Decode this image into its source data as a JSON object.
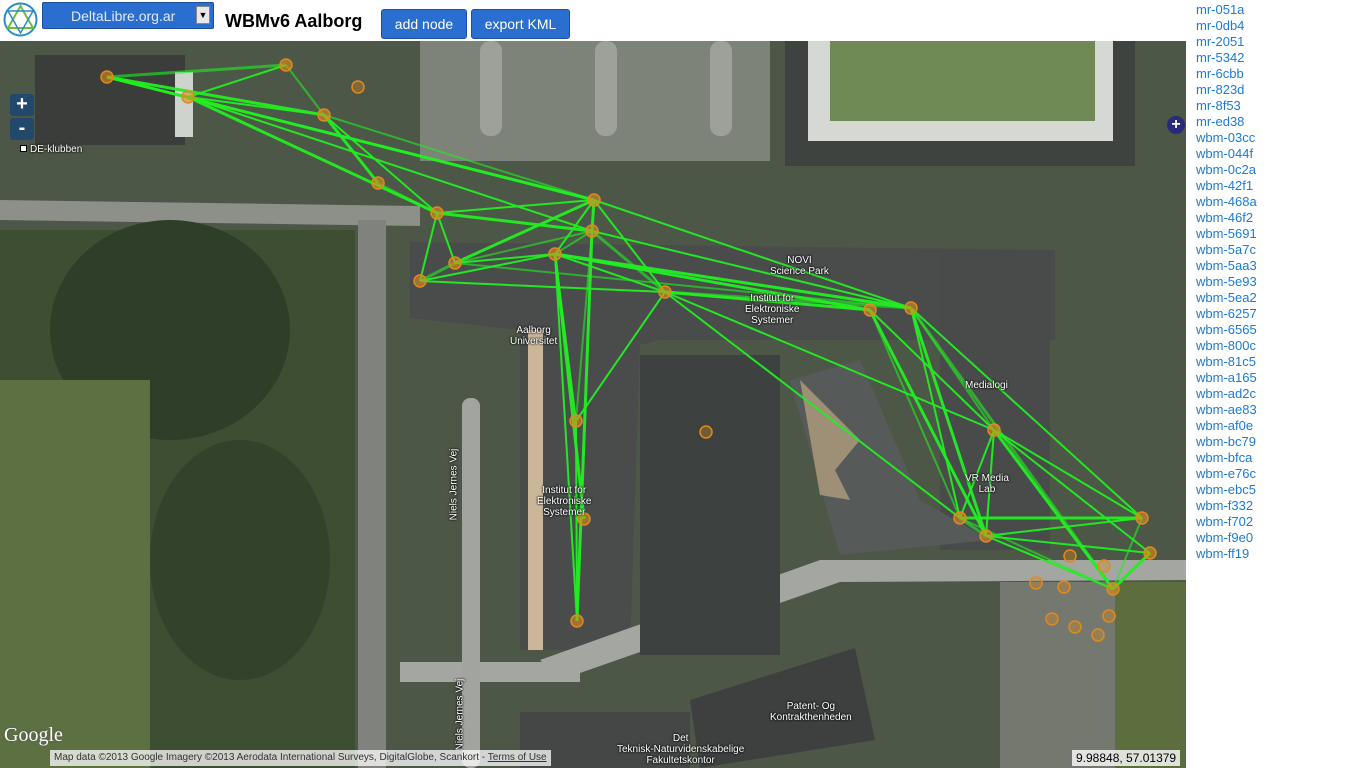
{
  "header": {
    "site_select": "DeltaLibre.org.ar",
    "title": "WBMv6 Aalborg",
    "add_node_label": "add node",
    "export_kml_label": "export KML"
  },
  "map": {
    "zoom_in": "+",
    "zoom_out": "-",
    "layer_switch": "+",
    "labels": [
      "DE-klubben",
      "NOVI\nScience Park",
      "Institut for\nElektroniske\nSystemer",
      "Aalborg\nUniversitet",
      "Medialogi",
      "VR Media\nLab",
      "Institut for\nElektroniske\nSystemer",
      "Niels Jernes Vej",
      "Niels Jernes Vej",
      "Patent- Og\nKontrakthenheden",
      "Det\nTeknisk-Naturvidenskabelige\nFakultetskontor"
    ],
    "google": "Google",
    "attribution": "Map data ©2013 Google Imagery ©2013 Aerodata International Surveys, DigitalGlobe, Scankort - ",
    "terms": "Terms of Use",
    "coordinates": "9.98848, 57.01379",
    "link_color": "#22ee22",
    "node_color": "#e08a1e"
  },
  "nodes": [
    "mr-051a",
    "mr-0db4",
    "mr-2051",
    "mr-5342",
    "mr-6cbb",
    "mr-823d",
    "mr-8f53",
    "mr-ed38",
    "wbm-03cc",
    "wbm-044f",
    "wbm-0c2a",
    "wbm-42f1",
    "wbm-468a",
    "wbm-46f2",
    "wbm-5691",
    "wbm-5a7c",
    "wbm-5aa3",
    "wbm-5e93",
    "wbm-5ea2",
    "wbm-6257",
    "wbm-6565",
    "wbm-800c",
    "wbm-81c5",
    "wbm-a165",
    "wbm-ad2c",
    "wbm-ae83",
    "wbm-af0e",
    "wbm-bc79",
    "wbm-bfca",
    "wbm-e76c",
    "wbm-ebc5",
    "wbm-f332",
    "wbm-f702",
    "wbm-f9e0",
    "wbm-ff19"
  ]
}
